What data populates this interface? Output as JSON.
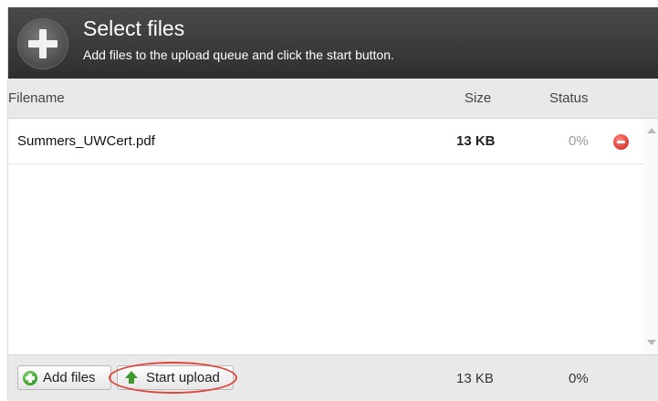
{
  "header": {
    "title": "Select files",
    "subtitle": "Add files to the upload queue and click the start button.",
    "icon": "add-circle-icon"
  },
  "columns": {
    "filename": "Filename",
    "size": "Size",
    "status": "Status"
  },
  "files": [
    {
      "name": "Summers_UWCert.pdf",
      "size": "13 KB",
      "status": "0%",
      "remove_icon": "remove-icon"
    }
  ],
  "footer": {
    "add_files_label": "Add files",
    "start_upload_label": "Start upload",
    "total_size": "13 KB",
    "total_status": "0%"
  },
  "colors": {
    "header_bg": "#333333",
    "highlight": "#e0443a",
    "remove": "#e0453a",
    "add_green": "#3ea32c"
  }
}
